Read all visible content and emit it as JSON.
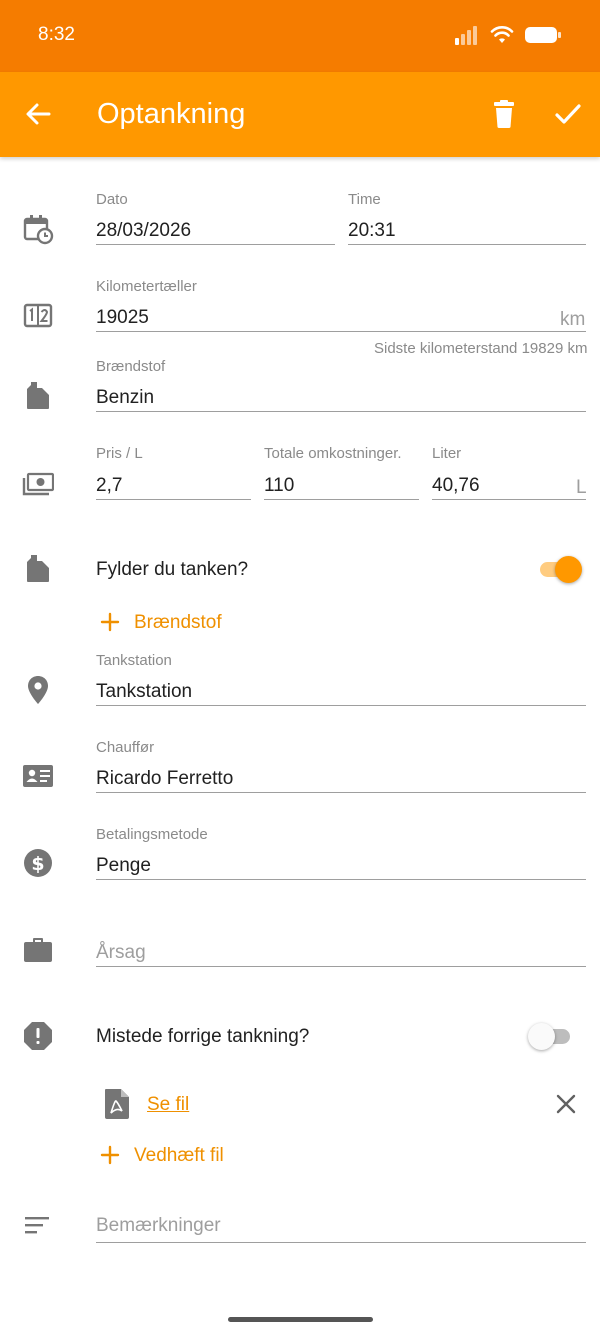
{
  "status_bar": {
    "time": "8:32"
  },
  "app_bar": {
    "title": "Optankning",
    "icons": [
      "arrow-back-icon",
      "trash-icon",
      "check-icon"
    ]
  },
  "form": {
    "date": {
      "label": "Dato",
      "value": "28/03/2026"
    },
    "time": {
      "label": "Time",
      "value": "20:31"
    },
    "odometer": {
      "label": "Kilometertæller",
      "value": "19025",
      "unit": "km",
      "helper": "Sidste kilometerstand 19829 km"
    },
    "fuel": {
      "label": "Brændstof",
      "value": "Benzin"
    },
    "price": {
      "label": "Pris / L",
      "value": "2,7"
    },
    "total": {
      "label": "Totale omkostninger.",
      "value": "110"
    },
    "liters": {
      "label": "Liter",
      "value": "40,76",
      "unit": "L"
    },
    "fill_tank": {
      "label": "Fylder du tanken?",
      "checked": true
    },
    "add_fuel": {
      "label": "Brændstof"
    },
    "station": {
      "label": "Tankstation",
      "value": "Tankstation"
    },
    "driver": {
      "label": "Chauffør",
      "value": "Ricardo Ferretto"
    },
    "payment": {
      "label": "Betalingsmetode",
      "value": "Penge"
    },
    "reason": {
      "placeholder": "Årsag"
    },
    "missed": {
      "label": "Mistede forrige tankning?",
      "checked": false
    },
    "attachment": {
      "link": "Se fil"
    },
    "attach_file": {
      "label": "Vedhæft fil"
    },
    "notes": {
      "placeholder": "Bemærkninger"
    }
  },
  "colors": {
    "status_bar": "#f57c00",
    "app_bar": "#ff9800",
    "accent": "#ef9000",
    "icon_gray": "#757575"
  }
}
